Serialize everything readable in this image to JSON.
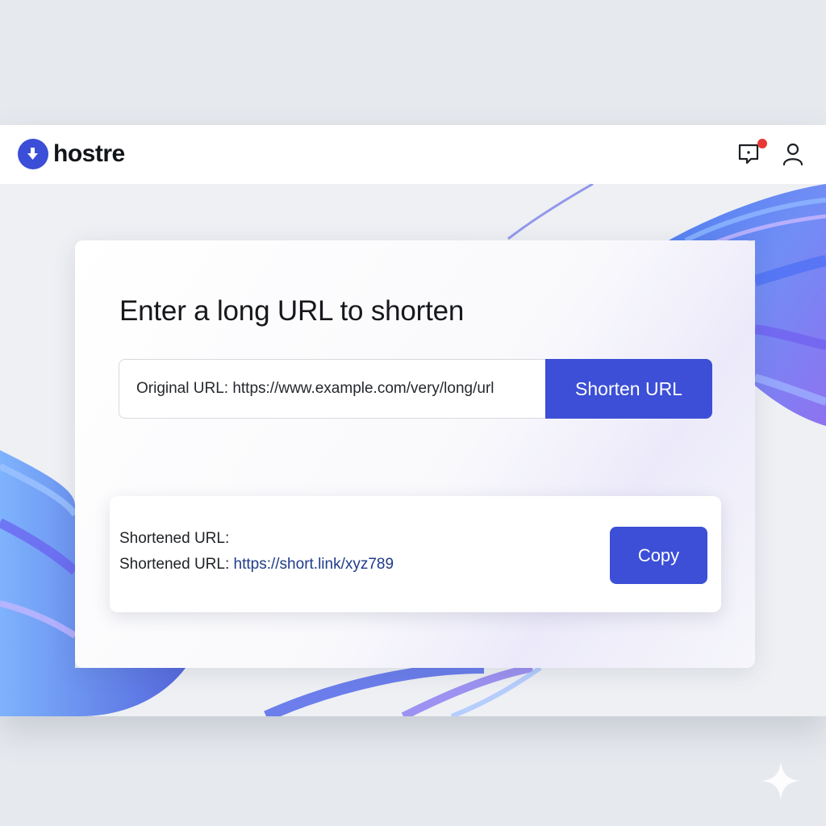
{
  "header": {
    "app_name": "hostre",
    "icons": [
      "logo-icon",
      "feedback-icon",
      "user-icon"
    ],
    "notification_dot_color": "#e53935"
  },
  "main": {
    "title": "Enter a long URL to shorten",
    "url_input_value": "Original URL: https://www.example.com/very/long/url",
    "shorten_button_label": "Shorten URL",
    "result": {
      "label": "Shortened URL:",
      "line_prefix": "Shortened URL:",
      "short_link": "https://short.link/xyz789",
      "copy_button_label": "Copy"
    }
  },
  "colors": {
    "accent": "#3c4fd6",
    "link": "#1f3a8a",
    "page_background": "#e6e9ee"
  }
}
